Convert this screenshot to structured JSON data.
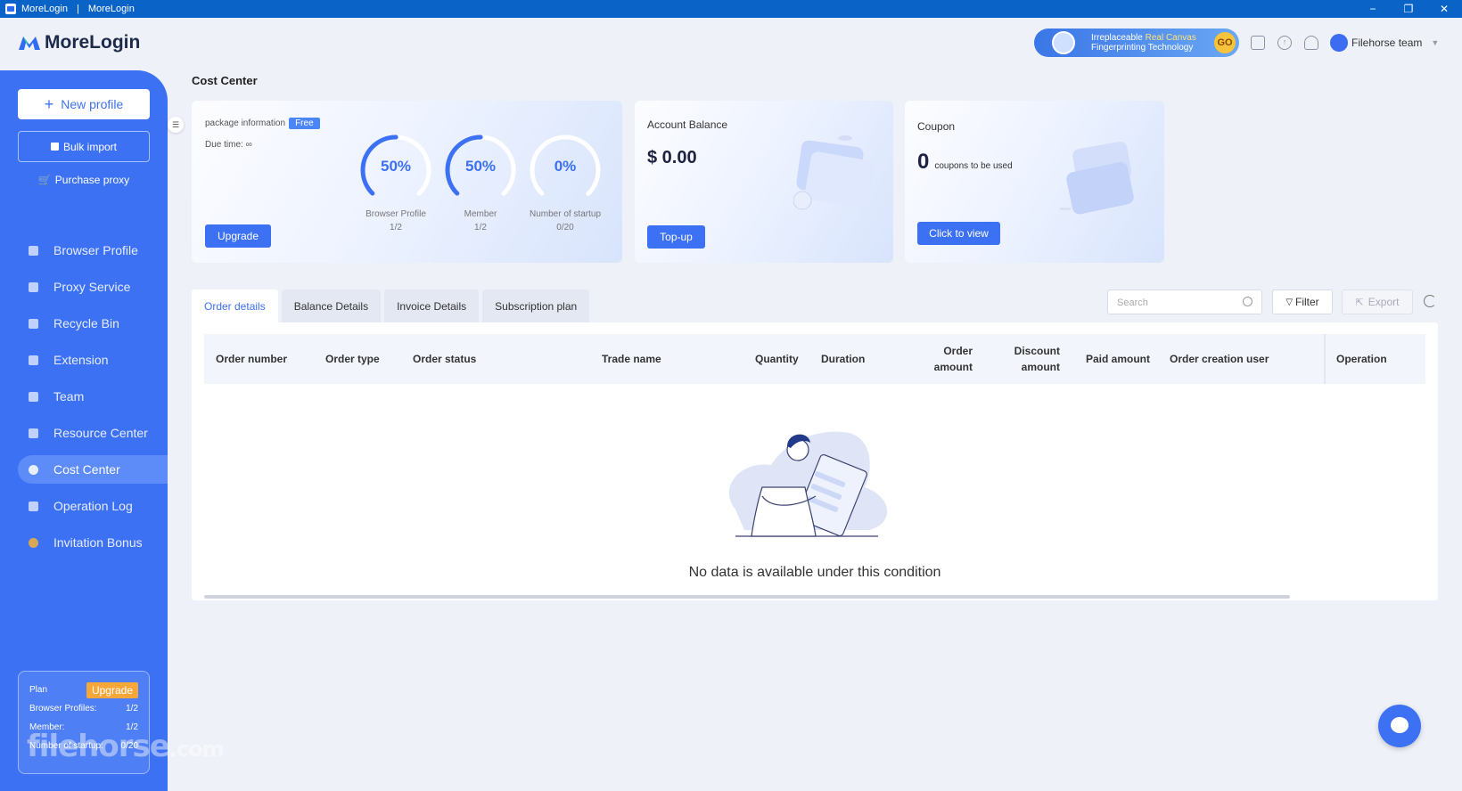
{
  "window": {
    "title_left": "MoreLogin",
    "title_right": "MoreLogin",
    "minimize": "−",
    "restore": "❐",
    "close": "✕"
  },
  "header": {
    "brand": "MoreLogin",
    "promo": {
      "line1_a": "Irreplaceable",
      "line1_b": "Real Canvas",
      "line2": "Fingerprinting Technology",
      "go": "GO"
    },
    "team_name": "Filehorse team"
  },
  "sidebar": {
    "new_profile": "New profile",
    "bulk_import": "Bulk import",
    "purchase_proxy": "Purchase proxy",
    "nav": [
      "Browser Profile",
      "Proxy Service",
      "Recycle Bin",
      "Extension",
      "Team",
      "Resource Center",
      "Cost Center",
      "Operation Log",
      "Invitation Bonus"
    ],
    "active": "Cost Center",
    "plan": {
      "label": "Plan",
      "upgrade": "Upgrade",
      "rows": [
        {
          "k": "Browser Profiles:",
          "v": "1/2"
        },
        {
          "k": "Member:",
          "v": "1/2"
        },
        {
          "k": "Number of startup:",
          "v": "0/20"
        }
      ]
    },
    "watermark": "filehorse",
    "watermark_tld": ".com"
  },
  "page": {
    "title": "Cost Center"
  },
  "package": {
    "label": "package information",
    "badge": "Free",
    "due_label": "Due time:",
    "due_value": "∞",
    "upgrade": "Upgrade",
    "gauges": [
      {
        "pct_text": "50%",
        "value": 0.5,
        "label": "Browser Profile",
        "ratio": "1/2"
      },
      {
        "pct_text": "50%",
        "value": 0.5,
        "label": "Member",
        "ratio": "1/2"
      },
      {
        "pct_text": "0%",
        "value": 0.0,
        "label": "Number of startup",
        "ratio": "0/20"
      }
    ]
  },
  "balance": {
    "label": "Account Balance",
    "amount": "$ 0.00",
    "topup": "Top-up"
  },
  "coupon": {
    "label": "Coupon",
    "count": "0",
    "count_text": "coupons to be used",
    "view": "Click to view"
  },
  "tabs": [
    "Order details",
    "Balance Details",
    "Invoice Details",
    "Subscription plan"
  ],
  "toolbar": {
    "search_placeholder": "Search",
    "filter": "Filter",
    "export": "Export"
  },
  "table": {
    "columns": [
      "Order number",
      "Order type",
      "Order status",
      "Trade name",
      "Quantity",
      "Duration",
      "Order amount",
      "Discount amount",
      "Paid amount",
      "Order creation user",
      "Operation"
    ],
    "rows": [],
    "empty_text": "No data is available under this condition"
  },
  "colors": {
    "accent": "#3d71f4",
    "sidebar": "#3d71f4",
    "titlebar": "#0a63c7",
    "upgrade_orange": "#f5a73a"
  }
}
